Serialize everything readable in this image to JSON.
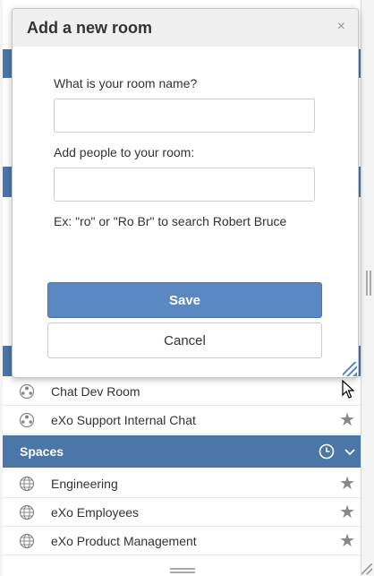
{
  "modal": {
    "title": "Add a new room",
    "close_glyph": "×",
    "room_name_label": "What is your room name?",
    "room_name_value": "",
    "add_people_label": "Add people to your room:",
    "add_people_value": "",
    "hint": "Ex: \"ro\" or \"Ro Br\" to search Robert Bruce",
    "save_label": "Save",
    "cancel_label": "Cancel"
  },
  "rooms": {
    "items": [
      {
        "label": "Chat Dev Room",
        "icon": "room-group-icon",
        "favorite": false
      },
      {
        "label": "eXo Support Internal Chat",
        "icon": "room-group-icon",
        "favorite": true
      }
    ]
  },
  "spaces": {
    "title": "Spaces",
    "items": [
      {
        "label": "Engineering",
        "icon": "space-globe-icon",
        "favorite": true
      },
      {
        "label": "eXo Employees",
        "icon": "space-globe-icon",
        "favorite": true
      },
      {
        "label": "eXo Product Management",
        "icon": "space-globe-icon",
        "favorite": true
      }
    ]
  },
  "colors": {
    "header_blue": "#4a76a8",
    "save_button": "#5b87c2",
    "star": "#888888"
  }
}
